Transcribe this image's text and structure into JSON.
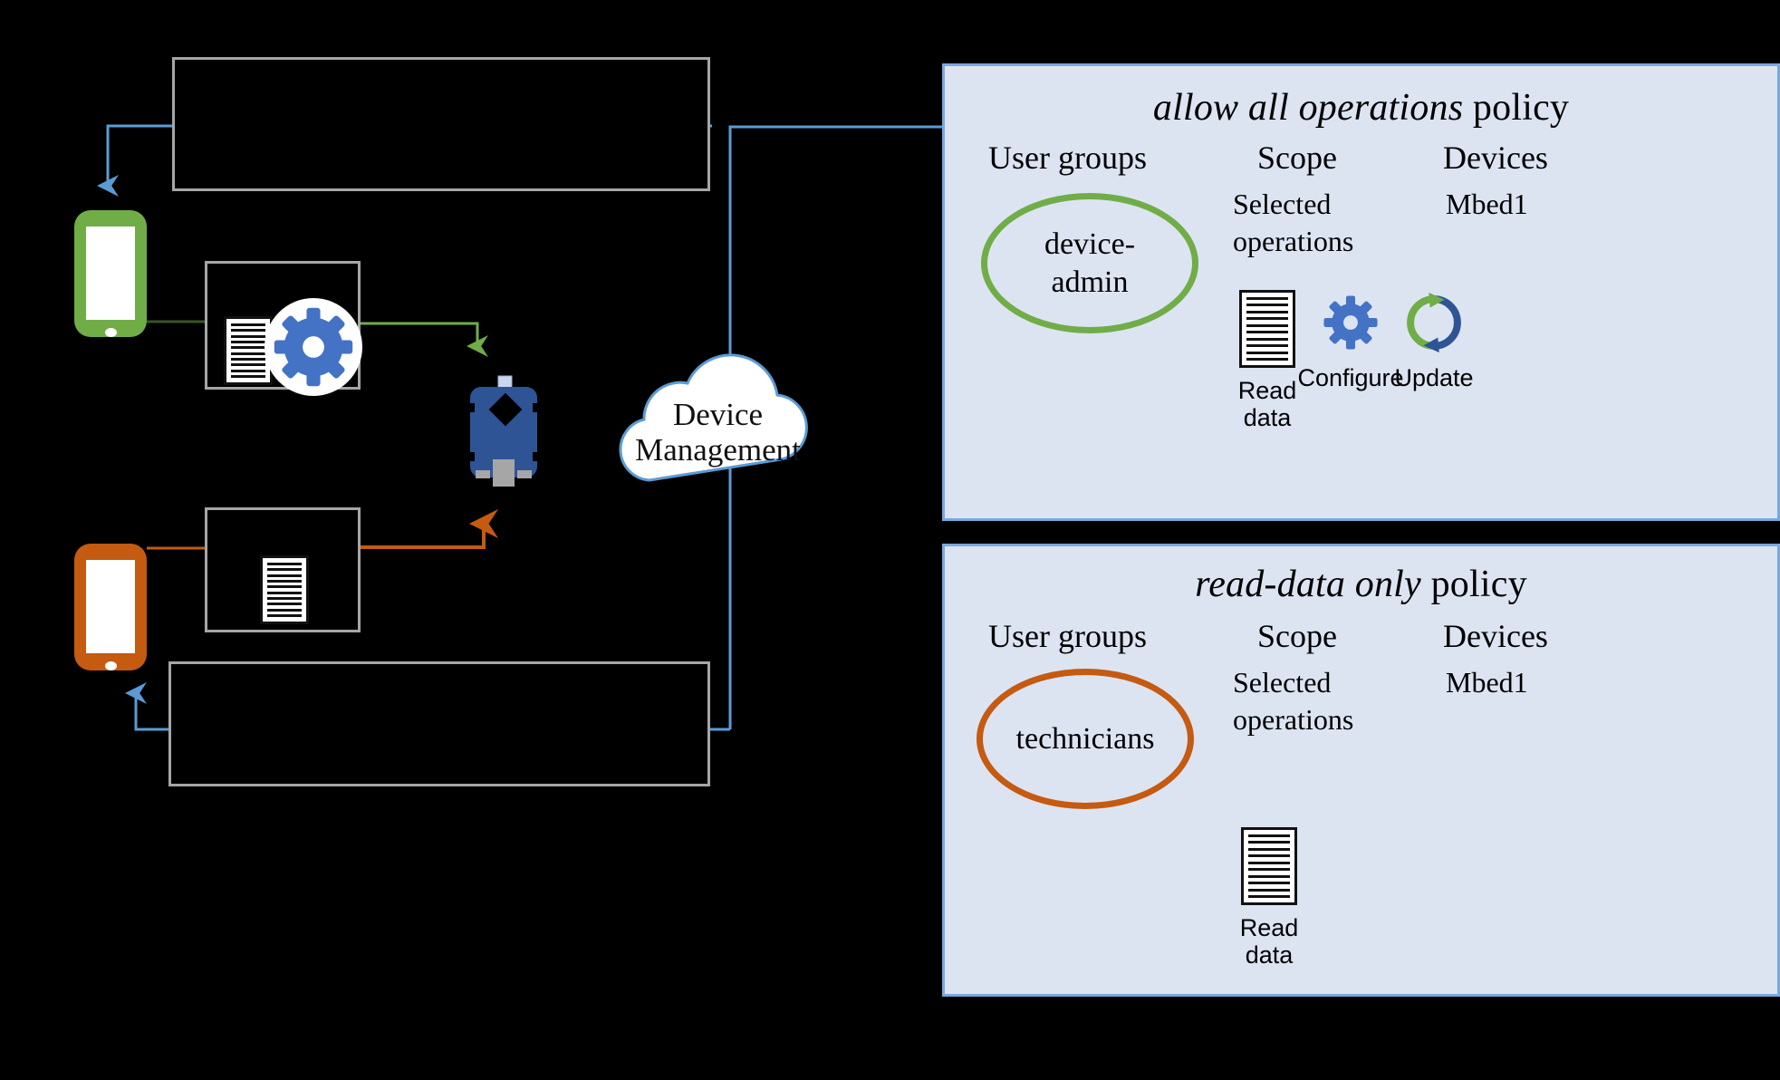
{
  "cloud": {
    "label": "Device\nManagement",
    "icon": "cloud-icon"
  },
  "device": {
    "name": "mbed-device-icon"
  },
  "left": {
    "boxes": [
      {
        "name": "top-annotation-box",
        "text": ""
      },
      {
        "name": "configure-action-box",
        "text": "",
        "icons": [
          "document-icon",
          "gear-icon"
        ]
      },
      {
        "name": "read-action-box",
        "text": "",
        "icons": [
          "document-icon"
        ]
      },
      {
        "name": "bottom-annotation-box",
        "text": ""
      }
    ],
    "phones": [
      {
        "name": "device-admin-phone",
        "color": "#70ad47"
      },
      {
        "name": "technician-phone",
        "color": "#c55a11"
      }
    ],
    "connectors": [
      {
        "name": "admin-policy-arrow",
        "color": "#5b9bd5"
      },
      {
        "name": "admin-operations-arrow",
        "color": "#70ad47"
      },
      {
        "name": "technician-operations-arrow",
        "color": "#c55a11"
      },
      {
        "name": "technician-policy-arrow",
        "color": "#5b9bd5"
      }
    ]
  },
  "policies": [
    {
      "id": "allow-all-operations",
      "title_emphasis": "allow all operations",
      "title_rest": " policy",
      "columns": {
        "user_groups_heading": "User groups",
        "scope_heading": "Scope",
        "devices_heading": "Devices",
        "scope_value": "Selected\noperations",
        "devices_value": "Mbed1",
        "group_value": "device-\nadmin"
      },
      "group_color": "#70ad47",
      "operations": [
        {
          "icon": "document-icon",
          "label": "Read\ndata"
        },
        {
          "icon": "gear-icon",
          "label": "Configure"
        },
        {
          "icon": "sync-icon",
          "label": "Update"
        }
      ]
    },
    {
      "id": "read-data-only",
      "title_emphasis": "read-data only",
      "title_rest": " policy",
      "columns": {
        "user_groups_heading": "User groups",
        "scope_heading": "Scope",
        "devices_heading": "Devices",
        "scope_value": "Selected\noperations",
        "devices_value": "Mbed1",
        "group_value": "technicians"
      },
      "group_color": "#c55a11",
      "operations": [
        {
          "icon": "document-icon",
          "label": "Read\ndata"
        }
      ]
    }
  ],
  "colors": {
    "panel_fill": "#dce4f2",
    "panel_border": "#7aa8e0",
    "green": "#70ad47",
    "orange": "#c55a11",
    "blue": "#5b9bd5",
    "gear_blue": "#4472c4",
    "device_blue": "#2e5496",
    "background": "#000000"
  }
}
